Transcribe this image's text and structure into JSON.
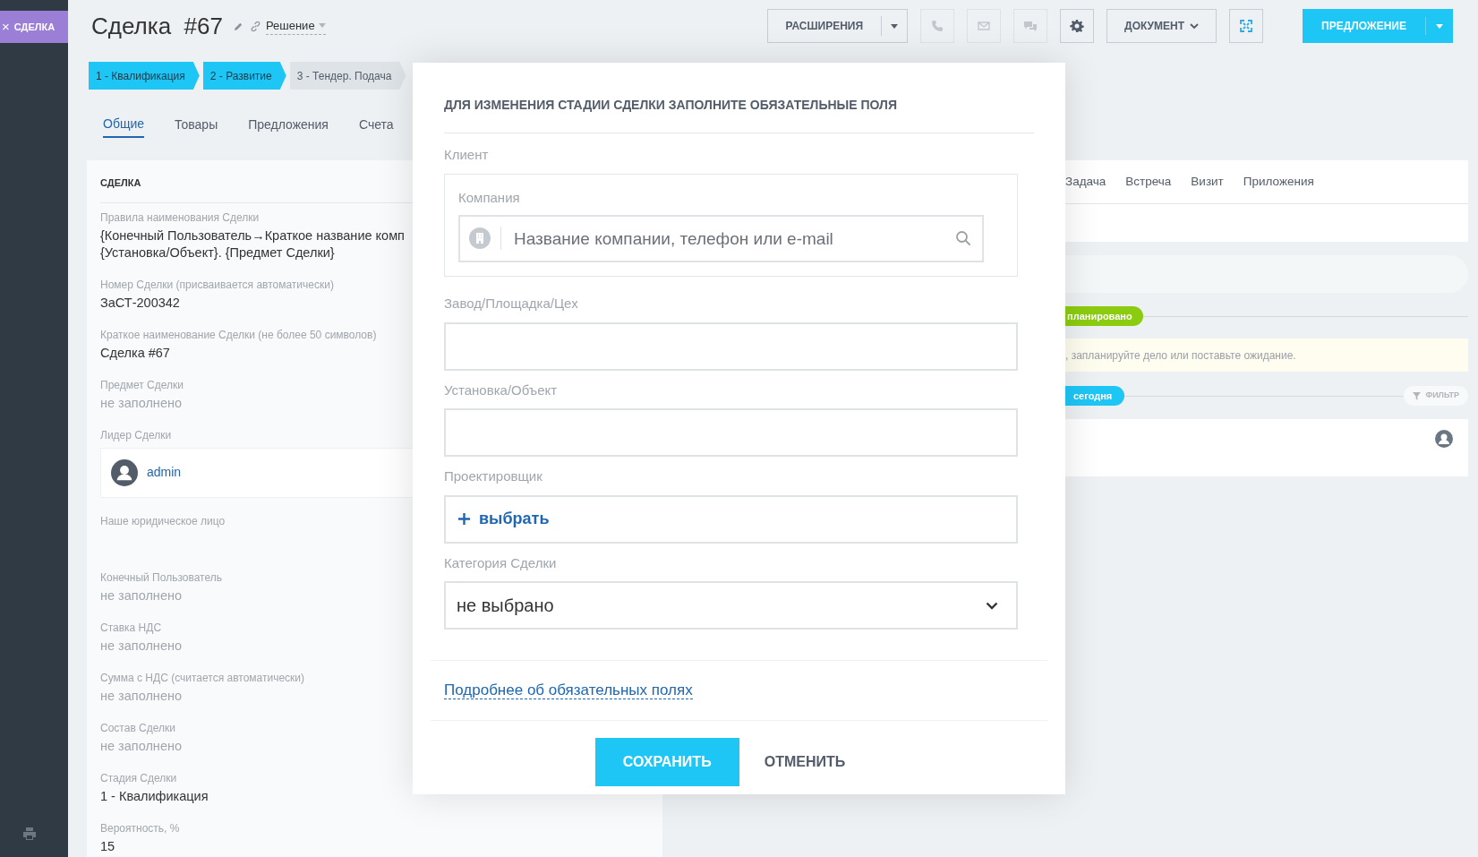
{
  "sidebar": {
    "deal_button": {
      "icon": "×",
      "label": "СДЕЛКА"
    }
  },
  "header": {
    "title": "Сделка  #67",
    "category": "Решение",
    "buttons": [
      {
        "kind": "split",
        "label": "РАСШИРЕНИЯ"
      },
      {
        "kind": "phone",
        "disabled": true
      },
      {
        "kind": "mail",
        "disabled": true
      },
      {
        "kind": "chat",
        "disabled": true
      },
      {
        "kind": "gear",
        "disabled": false
      },
      {
        "kind": "dropdown",
        "label": "ДОКУМЕНТ"
      },
      {
        "kind": "expand",
        "disabled": false
      },
      {
        "kind": "primary",
        "label": "ПРЕДЛОЖЕНИЕ"
      }
    ]
  },
  "stages": [
    {
      "label": "1 - Квалификация",
      "done": true
    },
    {
      "label": "2 - Развитие",
      "done": true
    },
    {
      "label": "3 - Тендер. Подача",
      "done": false
    }
  ],
  "tabs": [
    {
      "label": "Общие",
      "selected": true
    },
    {
      "label": "Товары",
      "selected": false
    },
    {
      "label": "Предложения",
      "selected": false
    },
    {
      "label": "Счета",
      "selected": false
    }
  ],
  "deal_card": {
    "title": "СДЕЛКА",
    "fields": [
      {
        "kind": "text",
        "label": "Правила наименования Сделки",
        "lines": [
          "{Конечный Пользователь→Краткое название комп",
          "{Установка/Объект}. {Предмет Сделки}"
        ]
      },
      {
        "kind": "text",
        "label": "Номер Сделки (присваивается автоматически)",
        "lines": [
          "ЗаСТ-200342"
        ]
      },
      {
        "kind": "text",
        "label": "Краткое наименование Сделки (не более 50 символов)",
        "lines": [
          "Сделка #67"
        ]
      },
      {
        "kind": "empty",
        "label": "Предмет Сделки",
        "lines": [
          "не заполнено"
        ]
      },
      {
        "kind": "user",
        "label": "Лидер Сделки",
        "lines": [
          "admin"
        ]
      },
      {
        "kind": "blank",
        "label": "Наше юридическое лицо"
      },
      {
        "kind": "empty",
        "label": "Конечный Пользователь",
        "lines": [
          "не заполнено"
        ]
      },
      {
        "kind": "empty",
        "label": "Ставка НДС",
        "lines": [
          "не заполнено"
        ]
      },
      {
        "kind": "empty",
        "label": "Сумма с НДС (считается автоматически)",
        "lines": [
          "не заполнено"
        ]
      },
      {
        "kind": "empty",
        "label": "Состав Сделки",
        "lines": [
          "не заполнено"
        ]
      },
      {
        "kind": "text",
        "label": "Стадия Сделки",
        "lines": [
          "1 - Квалификация"
        ]
      },
      {
        "kind": "text",
        "label": "Вероятность, %",
        "lines": [
          "15"
        ]
      }
    ]
  },
  "activity": {
    "tabs": [
      "Задача",
      "Встреча",
      "Визит",
      "Приложения"
    ],
    "planned_badge": "планировано",
    "hint": ", запланируйте дело или поставьте ожидание.",
    "today_badge": "сегодня",
    "filter": "ФИЛЬТР"
  },
  "modal": {
    "title": "ДЛЯ ИЗМЕНЕНИЯ СТАДИИ СДЕЛКИ ЗАПОЛНИТЕ ОБЯЗАТЕЛЬНЫЕ ПОЛЯ",
    "fields": [
      {
        "kind": "client",
        "label": "Клиент",
        "sublabel": "Компания",
        "placeholder": "Название компании, телефон или e-mail"
      },
      {
        "kind": "input",
        "label": "Завод/Площадка/Цех"
      },
      {
        "kind": "input",
        "label": "Установка/Объект"
      },
      {
        "kind": "picker",
        "label": "Проектировщик",
        "value": "выбрать"
      },
      {
        "kind": "select",
        "label": "Категория Сделки",
        "value": "не выбрано"
      }
    ],
    "link": "Подробнее об обязательных полях",
    "save": "СОХРАНИТЬ",
    "cancel": "ОТМЕНИТЬ"
  }
}
